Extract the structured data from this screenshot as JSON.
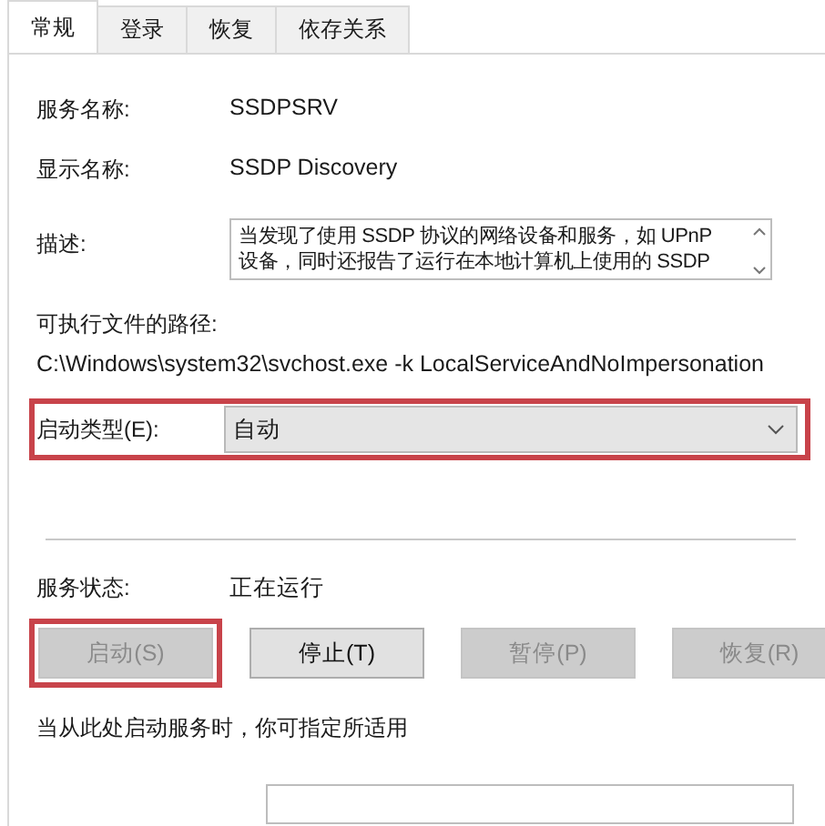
{
  "tabs": [
    {
      "label": "常规",
      "selected": true
    },
    {
      "label": "登录",
      "selected": false
    },
    {
      "label": "恢复",
      "selected": false
    },
    {
      "label": "依存关系",
      "selected": false
    }
  ],
  "service_name": {
    "label": "服务名称:",
    "value": "SSDPSRV"
  },
  "display_name": {
    "label": "显示名称:",
    "value": "SSDP Discovery"
  },
  "description": {
    "label": "描述:",
    "lines": [
      "当发现了使用 SSDP 协议的网络设备和服务，如 UPnP",
      "设备，同时还报告了运行在本地计算机上使用的 SSDP"
    ]
  },
  "executable_path": {
    "label": "可执行文件的路径:",
    "value": "C:\\Windows\\system32\\svchost.exe -k LocalServiceAndNoImpersonation"
  },
  "startup_type": {
    "label": "启动类型(E):",
    "value": "自动",
    "highlighted": true
  },
  "service_status": {
    "label": "服务状态:",
    "value": "正在运行"
  },
  "buttons": [
    {
      "label": "启动(S)",
      "disabled": true,
      "highlighted": true
    },
    {
      "label": "停止(T)",
      "disabled": false,
      "highlighted": false
    },
    {
      "label": "暂停(P)",
      "disabled": true,
      "highlighted": false
    },
    {
      "label": "恢复(R)",
      "disabled": true,
      "highlighted": false
    }
  ],
  "hint": "当从此处启动服务时，你可指定所适用"
}
